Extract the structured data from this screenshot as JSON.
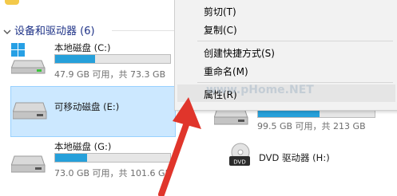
{
  "group_title": "设备和驱动器 (6)",
  "drives": [
    {
      "name": "本地磁盘 (C:)",
      "usage": "47.9 GB 可用，共 73.3 GB",
      "fill": 0.35
    },
    {
      "name": "可移动磁盘 (E:)"
    },
    {
      "name": "本地磁盘 (G:)",
      "usage": "73.0 GB 可用，共 101.6 GB",
      "fill": 0.28
    },
    {
      "usage": "99.5 GB 可用，共 213 GB",
      "fill": 0.53
    },
    {
      "name": "DVD 驱动器 (H:)"
    }
  ],
  "context_menu": {
    "items": [
      "剪切(T)",
      "复制(C)",
      "创建快捷方式(S)",
      "重命名(M)",
      "属性(R)"
    ],
    "highlighted_index": 4
  },
  "watermark": "www.pHome.NET",
  "colors": {
    "accent": "#26a0da",
    "selection_bg": "#cce8ff",
    "arrow": "#e0352b",
    "menu_highlight": "#e5e5e5"
  },
  "icons": [
    "windows-drive-icon",
    "drive-icon",
    "dvd-icon",
    "chevron-down-icon"
  ]
}
